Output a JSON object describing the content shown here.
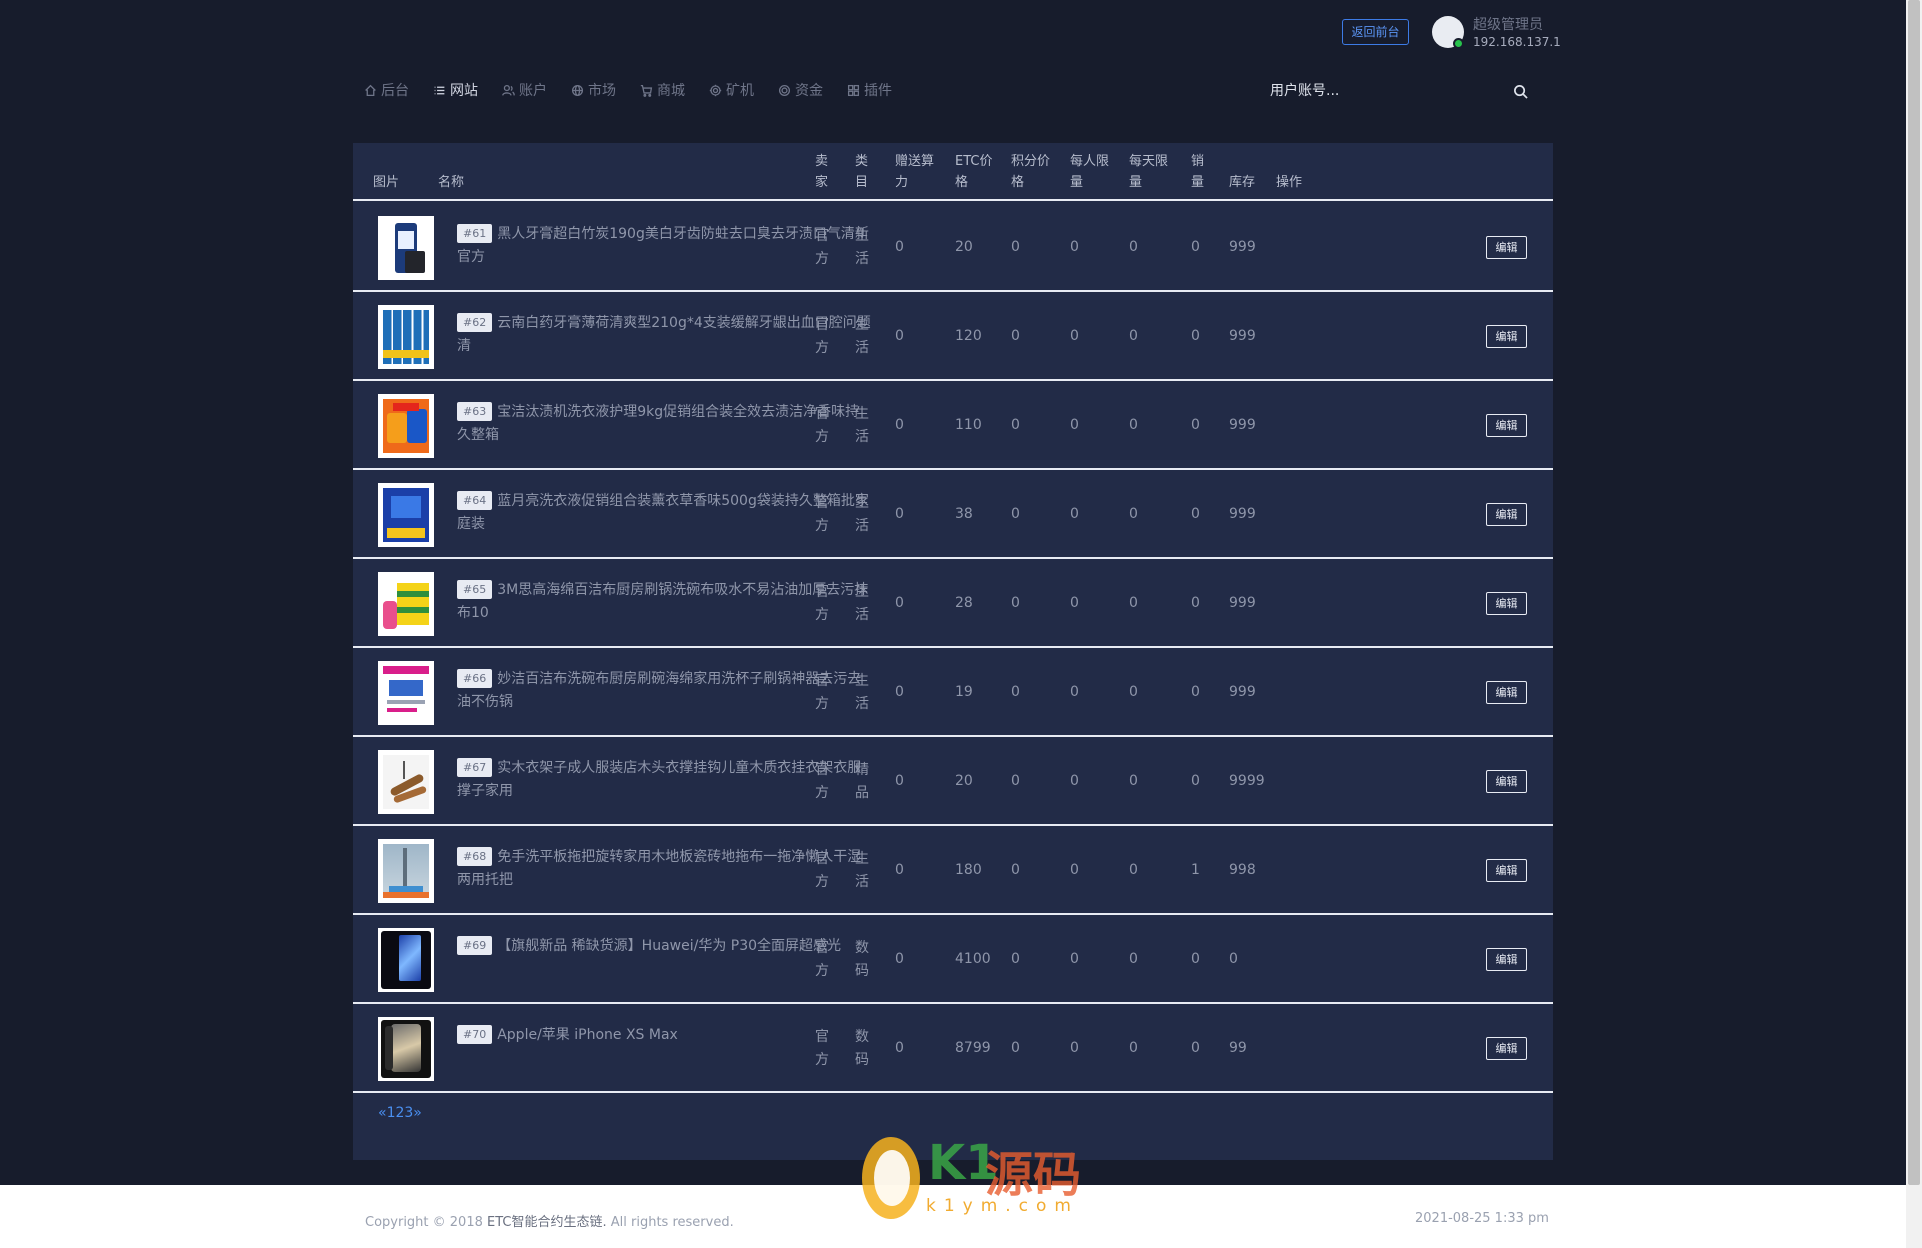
{
  "header": {
    "back_button": "返回前台",
    "user_name": "超级管理员",
    "user_ip": "192.168.137.1"
  },
  "nav": [
    {
      "label": "后台",
      "icon": "home-icon",
      "active": false
    },
    {
      "label": "网站",
      "icon": "list-icon",
      "active": true
    },
    {
      "label": "账户",
      "icon": "users-icon",
      "active": false
    },
    {
      "label": "市场",
      "icon": "globe-icon",
      "active": false
    },
    {
      "label": "商城",
      "icon": "cart-icon",
      "active": false
    },
    {
      "label": "矿机",
      "icon": "gear-icon",
      "active": false
    },
    {
      "label": "资金",
      "icon": "coin-icon",
      "active": false
    },
    {
      "label": "插件",
      "icon": "grid-icon",
      "active": false
    }
  ],
  "search": {
    "placeholder": "用户账号..."
  },
  "table": {
    "headers": {
      "image": "图片",
      "name": "名称",
      "seller": [
        "卖",
        "家"
      ],
      "category": [
        "类",
        "目"
      ],
      "bonus": [
        "赠送算",
        "力"
      ],
      "etc_price": [
        "ETC价",
        "格"
      ],
      "points_price": [
        "积分价",
        "格"
      ],
      "per_person": [
        "每人限",
        "量"
      ],
      "per_day": [
        "每天限",
        "量"
      ],
      "sales": [
        "销",
        "量"
      ],
      "stock": "库存",
      "action": "操作"
    },
    "edit_label": "编辑",
    "rows": [
      {
        "id": "#61",
        "name_l1": "黑人牙膏超白竹炭190g美白牙齿防蛀去口臭去牙渍口气清新",
        "name_l2": "官方",
        "seller": [
          "官",
          "方"
        ],
        "category": [
          "生",
          "活"
        ],
        "bonus": "0",
        "etc_price": "20",
        "points_price": "0",
        "per_person": "0",
        "per_day": "0",
        "sales": "0",
        "stock": "999",
        "thumb": "toothpaste-thumb"
      },
      {
        "id": "#62",
        "name_l1": "云南白药牙膏薄荷清爽型210g*4支装缓解牙龈出血口腔问题",
        "name_l2": "清",
        "seller": [
          "官",
          "方"
        ],
        "category": [
          "生",
          "活"
        ],
        "bonus": "0",
        "etc_price": "120",
        "points_price": "0",
        "per_person": "0",
        "per_day": "0",
        "sales": "0",
        "stock": "999",
        "thumb": "toothpaste-pack-thumb"
      },
      {
        "id": "#63",
        "name_l1": "宝洁汰渍机洗衣液护理9kg促销组合装全效去渍洁净香味持",
        "name_l2": "久整箱",
        "seller": [
          "官",
          "方"
        ],
        "category": [
          "生",
          "活"
        ],
        "bonus": "0",
        "etc_price": "110",
        "points_price": "0",
        "per_person": "0",
        "per_day": "0",
        "sales": "0",
        "stock": "999",
        "thumb": "detergent-thumb"
      },
      {
        "id": "#64",
        "name_l1": "蓝月亮洗衣液促销组合装薰衣草香味500g袋装持久整箱批家",
        "name_l2": "庭装",
        "seller": [
          "官",
          "方"
        ],
        "category": [
          "生",
          "活"
        ],
        "bonus": "0",
        "etc_price": "38",
        "points_price": "0",
        "per_person": "0",
        "per_day": "0",
        "sales": "0",
        "stock": "999",
        "thumb": "laundry-thumb"
      },
      {
        "id": "#65",
        "name_l1": "3M思高海绵百洁布厨房刷锅洗碗布吸水不易沾油加厚去污抹",
        "name_l2": "布10",
        "seller": [
          "官",
          "方"
        ],
        "category": [
          "生",
          "活"
        ],
        "bonus": "0",
        "etc_price": "28",
        "points_price": "0",
        "per_person": "0",
        "per_day": "0",
        "sales": "0",
        "stock": "999",
        "thumb": "sponge-thumb"
      },
      {
        "id": "#66",
        "name_l1": "妙洁百洁布洗碗布厨房刷碗海绵家用洗杯子刷锅神器去污去",
        "name_l2": "油不伤锅",
        "seller": [
          "官",
          "方"
        ],
        "category": [
          "生",
          "活"
        ],
        "bonus": "0",
        "etc_price": "19",
        "points_price": "0",
        "per_person": "0",
        "per_day": "0",
        "sales": "0",
        "stock": "999",
        "thumb": "scrubber-thumb"
      },
      {
        "id": "#67",
        "name_l1": "实木衣架子成人服装店木头衣撑挂钩儿童木质衣挂衣架衣服",
        "name_l2": "撑子家用",
        "seller": [
          "官",
          "方"
        ],
        "category": [
          "精",
          "品"
        ],
        "bonus": "0",
        "etc_price": "20",
        "points_price": "0",
        "per_person": "0",
        "per_day": "0",
        "sales": "0",
        "stock": "9999",
        "thumb": "hanger-thumb"
      },
      {
        "id": "#68",
        "name_l1": "免手洗平板拖把旋转家用木地板瓷砖地拖布一拖净懒人干湿",
        "name_l2": "两用托把",
        "seller": [
          "官",
          "方"
        ],
        "category": [
          "生",
          "活"
        ],
        "bonus": "0",
        "etc_price": "180",
        "points_price": "0",
        "per_person": "0",
        "per_day": "0",
        "sales": "1",
        "stock": "998",
        "thumb": "mop-thumb"
      },
      {
        "id": "#69",
        "name_l1": "【旗舰新品 稀缺货源】Huawei/华为 P30全面屏超感光",
        "name_l2": "",
        "seller": [
          "官",
          "方"
        ],
        "category": [
          "数",
          "码"
        ],
        "bonus": "0",
        "etc_price": "4100",
        "points_price": "0",
        "per_person": "0",
        "per_day": "0",
        "sales": "0",
        "stock": "0",
        "thumb": "huawei-phone-thumb"
      },
      {
        "id": "#70",
        "name_l1": "Apple/苹果 iPhone XS Max",
        "name_l2": "",
        "seller": [
          "官",
          "方"
        ],
        "category": [
          "数",
          "码"
        ],
        "bonus": "0",
        "etc_price": "8799",
        "points_price": "0",
        "per_person": "0",
        "per_day": "0",
        "sales": "0",
        "stock": "99",
        "thumb": "iphone-thumb"
      }
    ]
  },
  "pagination": {
    "label": "«123»"
  },
  "footer": {
    "copyright_prefix": "Copyright © 2018",
    "company": "ETC智能合约生态链.",
    "copyright_suffix": "All rights reserved.",
    "datetime": "2021-08-25 1:33 pm"
  },
  "watermark": {
    "logo_k1": "K1",
    "logo_yuan": "源码",
    "url": "k1ym.com"
  },
  "colors": {
    "page_bg": "#171c2c",
    "panel_bg": "#222b47",
    "accent_blue": "#3d7be6",
    "online_green": "#27c24c",
    "divider": "#e8ebf3"
  }
}
